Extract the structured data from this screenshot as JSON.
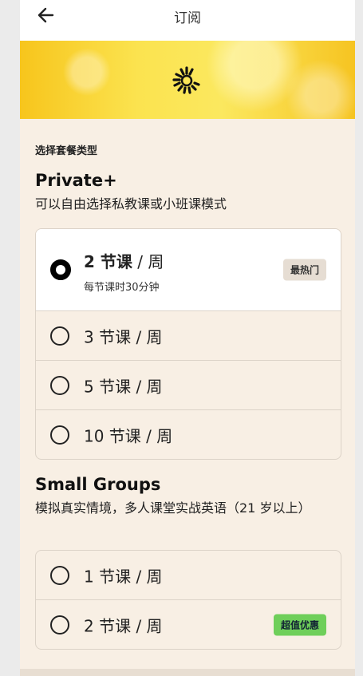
{
  "header": {
    "title": "订阅",
    "back_icon": "arrow-left-icon"
  },
  "banner": {
    "logo_icon": "sunburst-logo"
  },
  "section_label": "选择套餐类型",
  "plans": [
    {
      "title": "Private+",
      "description": "可以自由选择私教课或小班课模式",
      "options": [
        {
          "label_num": "2 节课",
          "label_unit": " / 周",
          "subtitle": "每节课时30分钟",
          "badge": "最热门",
          "selected": true
        },
        {
          "label_num": "3 节课",
          "label_unit": " / 周",
          "selected": false
        },
        {
          "label_num": "5 节课",
          "label_unit": " / 周",
          "selected": false
        },
        {
          "label_num": "10 节课",
          "label_unit": " / 周",
          "selected": false
        }
      ]
    },
    {
      "title": "Small Groups",
      "description": "模拟真实情境，多人课堂实战英语（21 岁以上）",
      "options": [
        {
          "label_num": "1 节课",
          "label_unit": " / 周",
          "selected": false
        },
        {
          "label_num": "2 节课",
          "label_unit": " / 周",
          "badge": "超值优惠",
          "selected": false
        }
      ]
    }
  ],
  "colors": {
    "hot_badge": "#e6ddd3",
    "deal_badge": "#6fcf5a",
    "background": "#f8efe4"
  }
}
